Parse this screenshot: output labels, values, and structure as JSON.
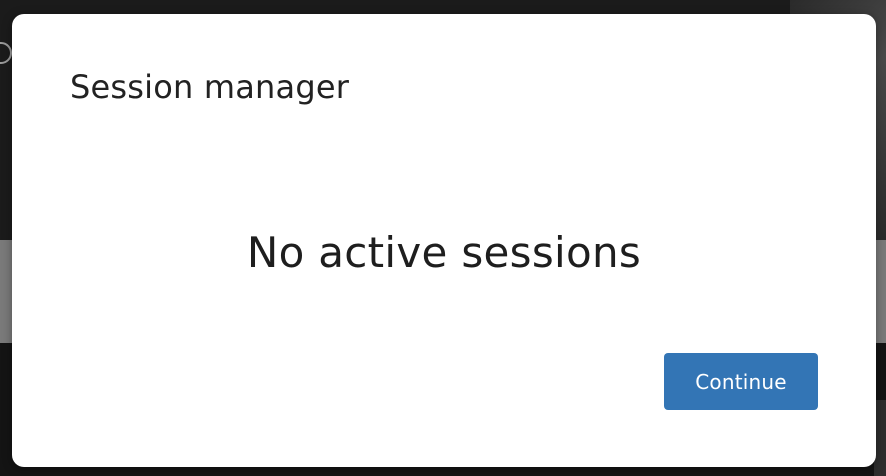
{
  "modal": {
    "title": "Session manager",
    "message": "No active sessions",
    "continue_label": "Continue",
    "accent_color": "#3375b5"
  }
}
